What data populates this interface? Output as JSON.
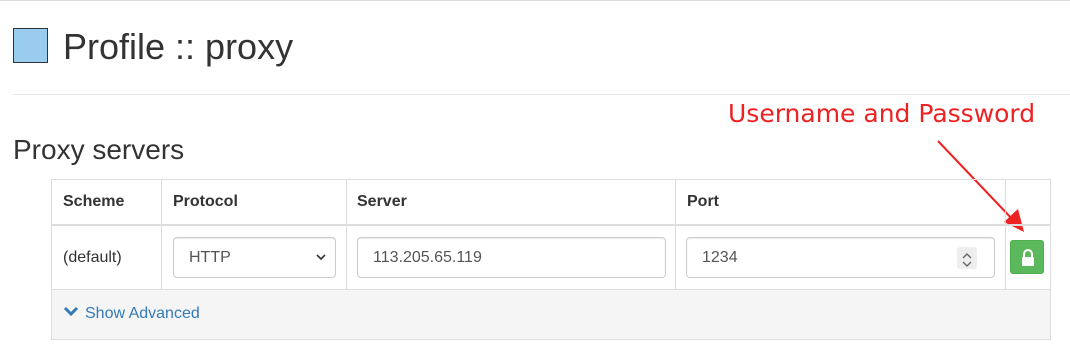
{
  "header": {
    "profile_color": "#99ccee",
    "title": "Profile :: proxy"
  },
  "annotation": {
    "text": "Username and Password",
    "color": "#ee2222"
  },
  "section": {
    "heading": "Proxy servers"
  },
  "table": {
    "columns": [
      "Scheme",
      "Protocol",
      "Server",
      "Port"
    ],
    "row": {
      "scheme": "(default)",
      "protocol": "HTTP",
      "server": "113.205.65.119",
      "port": "1234"
    }
  },
  "footer": {
    "show_advanced_label": "Show Advanced"
  },
  "icons": {
    "lock": "lock-icon",
    "chevron_down": "chevron-down-icon",
    "spinner": "spinner-icon"
  },
  "colors": {
    "accent_link": "#337ab7",
    "auth_button": "#5cb85c"
  }
}
